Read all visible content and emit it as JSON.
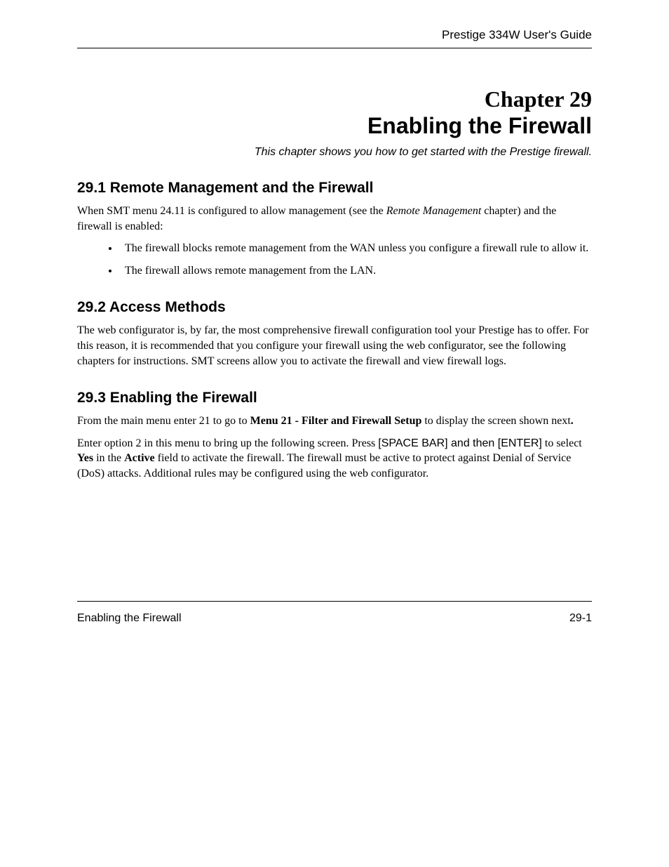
{
  "header": {
    "doc_title": "Prestige 334W User's Guide"
  },
  "chapter": {
    "label": "Chapter 29",
    "title": "Enabling the Firewall",
    "subtitle": "This chapter shows you how to get started with the Prestige firewall."
  },
  "section1": {
    "heading": "29.1  Remote Management and the Firewall",
    "para_pre": "When SMT menu 24.11 is configured to allow management (see the ",
    "para_em": "Remote Management",
    "para_post": " chapter) and the firewall is enabled:",
    "bullets": [
      "The firewall blocks remote management from the WAN unless you configure a firewall rule to allow it.",
      "The firewall allows remote management from the LAN."
    ]
  },
  "section2": {
    "heading": "29.2  Access Methods",
    "para": "The web configurator is, by far, the most comprehensive firewall configuration tool your Prestige has to offer. For this reason, it is recommended that you configure your firewall using the web configurator, see the following chapters for instructions. SMT screens allow you to activate the firewall and view firewall logs."
  },
  "section3": {
    "heading": "29.3  Enabling the Firewall",
    "p1_pre": "From the main menu enter 21 to go to ",
    "p1_bold": "Menu 21 - Filter and Firewall Setup",
    "p1_post": " to display the screen shown next",
    "p1_period": ".",
    "p2_a": "Enter option 2 in this menu to bring up the following screen. Press ",
    "p2_key1": "[SPACE BAR]",
    "p2_mid1": " and then ",
    "p2_key2": "[ENTER]",
    "p2_b": " to select ",
    "p2_yes": "Yes",
    "p2_c": " in the ",
    "p2_active": "Active",
    "p2_d": " field to activate the firewall. The firewall must be active to protect against Denial of Service (DoS) attacks. Additional rules may be configured using the web configurator."
  },
  "footer": {
    "left": "Enabling the Firewall",
    "right": "29-1"
  }
}
